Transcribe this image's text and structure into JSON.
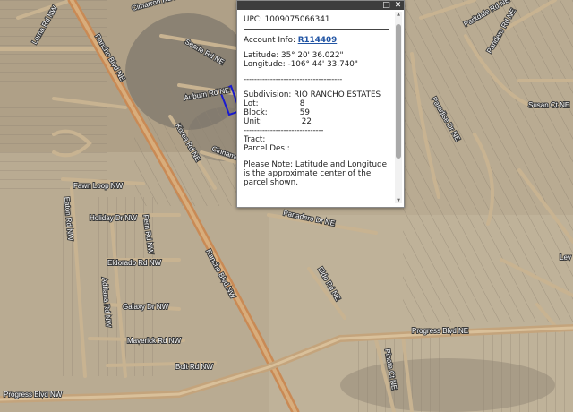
{
  "map": {
    "roads": [
      "Rancho Blvd NE",
      "Rancho Blvd NW",
      "Progress Blvd NW",
      "Progress Blvd NE",
      "Loma Rd NW",
      "Cimarron Rd NE",
      "Cinnamon Rd NE",
      "Searle Rd NE",
      "Auburn Rd NE",
      "Korea Rd NE",
      "Fawn Loop NW",
      "Eaton Rd NW",
      "Holiday Dr NW",
      "Fern Rd NW",
      "Eldorado Rd NW",
      "Adriana Rd NW",
      "Galaxy Dr NW",
      "Maverick Rd NW",
      "Bolt Rd NW",
      "Panadero Dr NE",
      "Paradise Dr NE",
      "Eldo Rd NE",
      "Susan Ct NE",
      "Pandero Rd NE",
      "Parkdale Rd NE",
      "Pinata Ct NE",
      "Lev"
    ]
  },
  "popup": {
    "title_bar_buttons": [
      "maximize",
      "close"
    ],
    "upc_label": "UPC:",
    "upc_value": "1009075066341",
    "account_label": "Account Info:",
    "account_value": "R114409",
    "latitude_label": "Latitude:",
    "latitude_value": "35° 20' 36.022\"",
    "longitude_label": "Longitude:",
    "longitude_value": "-106° 44' 33.740\"",
    "divider_dashes": "-------------------------------------",
    "subdivision_label": "Subdivision:",
    "subdivision_value": "RIO RANCHO ESTATES",
    "lot_label": "Lot:",
    "lot_value": "8",
    "block_label": "Block:",
    "block_value": "59",
    "unit_label": "Unit:",
    "unit_value": "22",
    "divider_dashes_2": "------------------------------",
    "tract_label": "Tract:",
    "parcel_label": "Parcel Des.:",
    "note_text": "Please Note: Latitude and Longitude is the approximate center of the parcel shown."
  },
  "icons": {
    "maximize": "maximize-icon",
    "close": "close-icon"
  },
  "colors": {
    "terrain": "#b9ab92",
    "road": "#c3ab84",
    "highlight_parcel": "#1a1ad0",
    "arterial": "#c98a55"
  }
}
